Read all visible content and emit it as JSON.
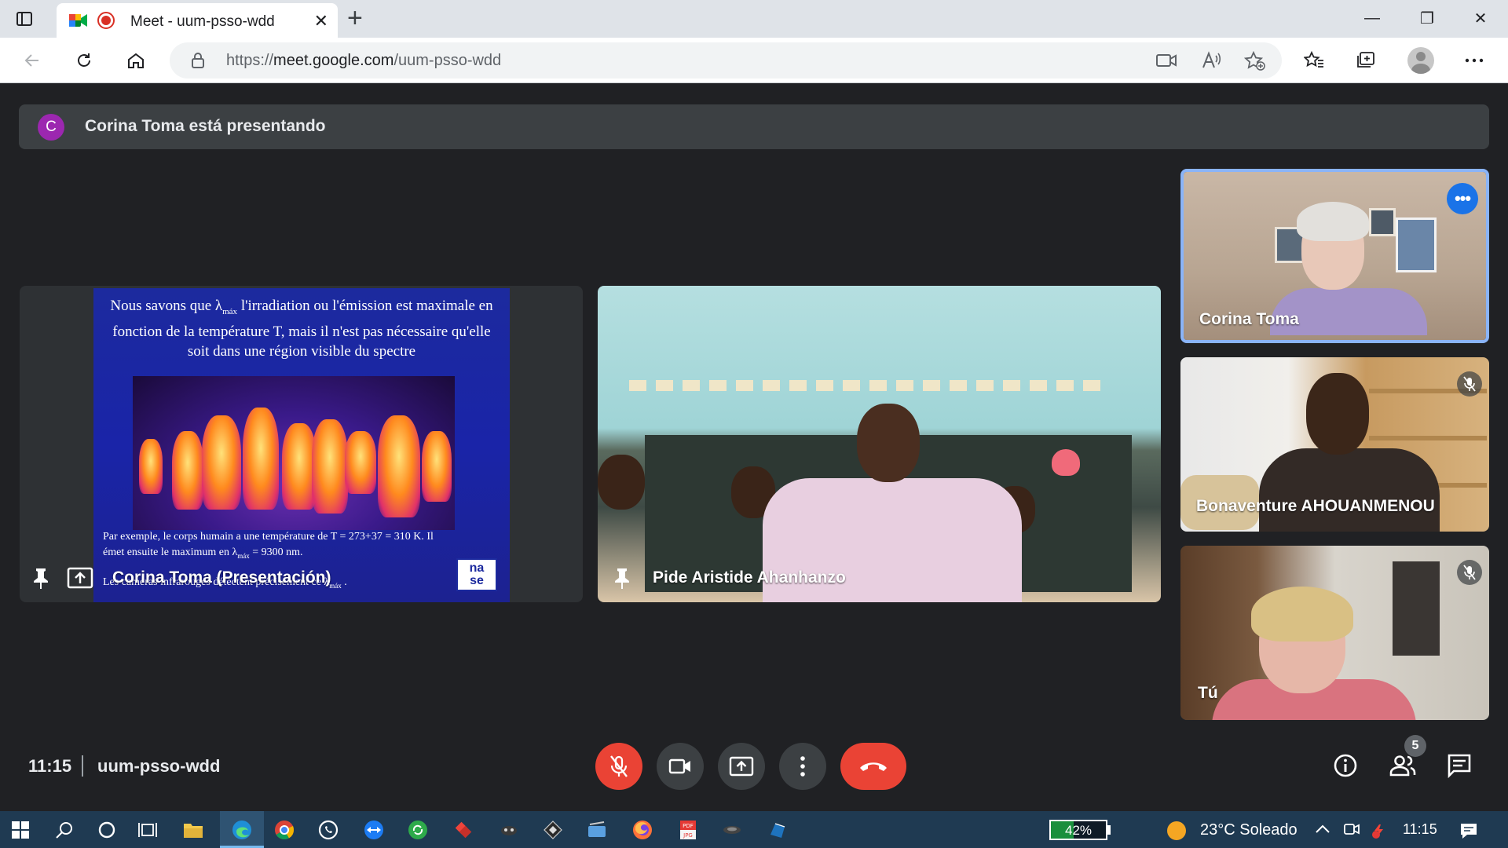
{
  "browser": {
    "tab_title": "Meet - uum-psso-wdd",
    "tab_close": "✕",
    "new_tab": "+",
    "url_prefix": "https://",
    "url_host": "meet.google.com",
    "url_path": "/uum-psso-wdd",
    "window_min": "—",
    "window_restore": "❐",
    "window_close": "✕"
  },
  "meet": {
    "banner_initial": "C",
    "banner_text": "Corina Toma está presentando",
    "main_tiles": [
      {
        "name": "Corina Toma (Presentación)"
      },
      {
        "name": "Pide Aristide Ahanhanzo"
      }
    ],
    "side_tiles": [
      {
        "name": "Corina Toma"
      },
      {
        "name": "Bonaventure AHOUANMENOU"
      },
      {
        "name": "Tú"
      }
    ],
    "slide": {
      "heading_part1": "Nous savons que λ",
      "heading_sub": "máx",
      "heading_part2": " l'irradiation ou l'émission est maximale en fonction de la température T, mais il n'est pas nécessaire qu'elle soit dans une région visible du spectre",
      "body_line1": "Par exemple, le corps humain a une température de T = 273+37 = 310 K.  Il",
      "body_line2_a": "émet ensuite le maximum en λ",
      "body_line2_sub": "máx",
      "body_line2_b": " = 9300 nm.",
      "body_line3_a": "Les caméras infrarouges détectent précisément ce λ",
      "body_line3_sub": "máx",
      "body_line3_b": " .",
      "logo_top": "na",
      "logo_bottom": "se"
    },
    "more_label": "•••",
    "time": "11:15",
    "meeting_code": "uum-psso-wdd",
    "people_count": "5"
  },
  "taskbar": {
    "battery_percent": "42%",
    "battery_level": 0.42,
    "weather": "23°C  Soleado",
    "clock": "11:15"
  },
  "colors": {
    "meet_bg": "#202124",
    "tile_bg": "#3c4043",
    "end_call": "#ea4335",
    "accent_blue": "#1a73e8",
    "taskbar_bg": "#1f3a52"
  }
}
